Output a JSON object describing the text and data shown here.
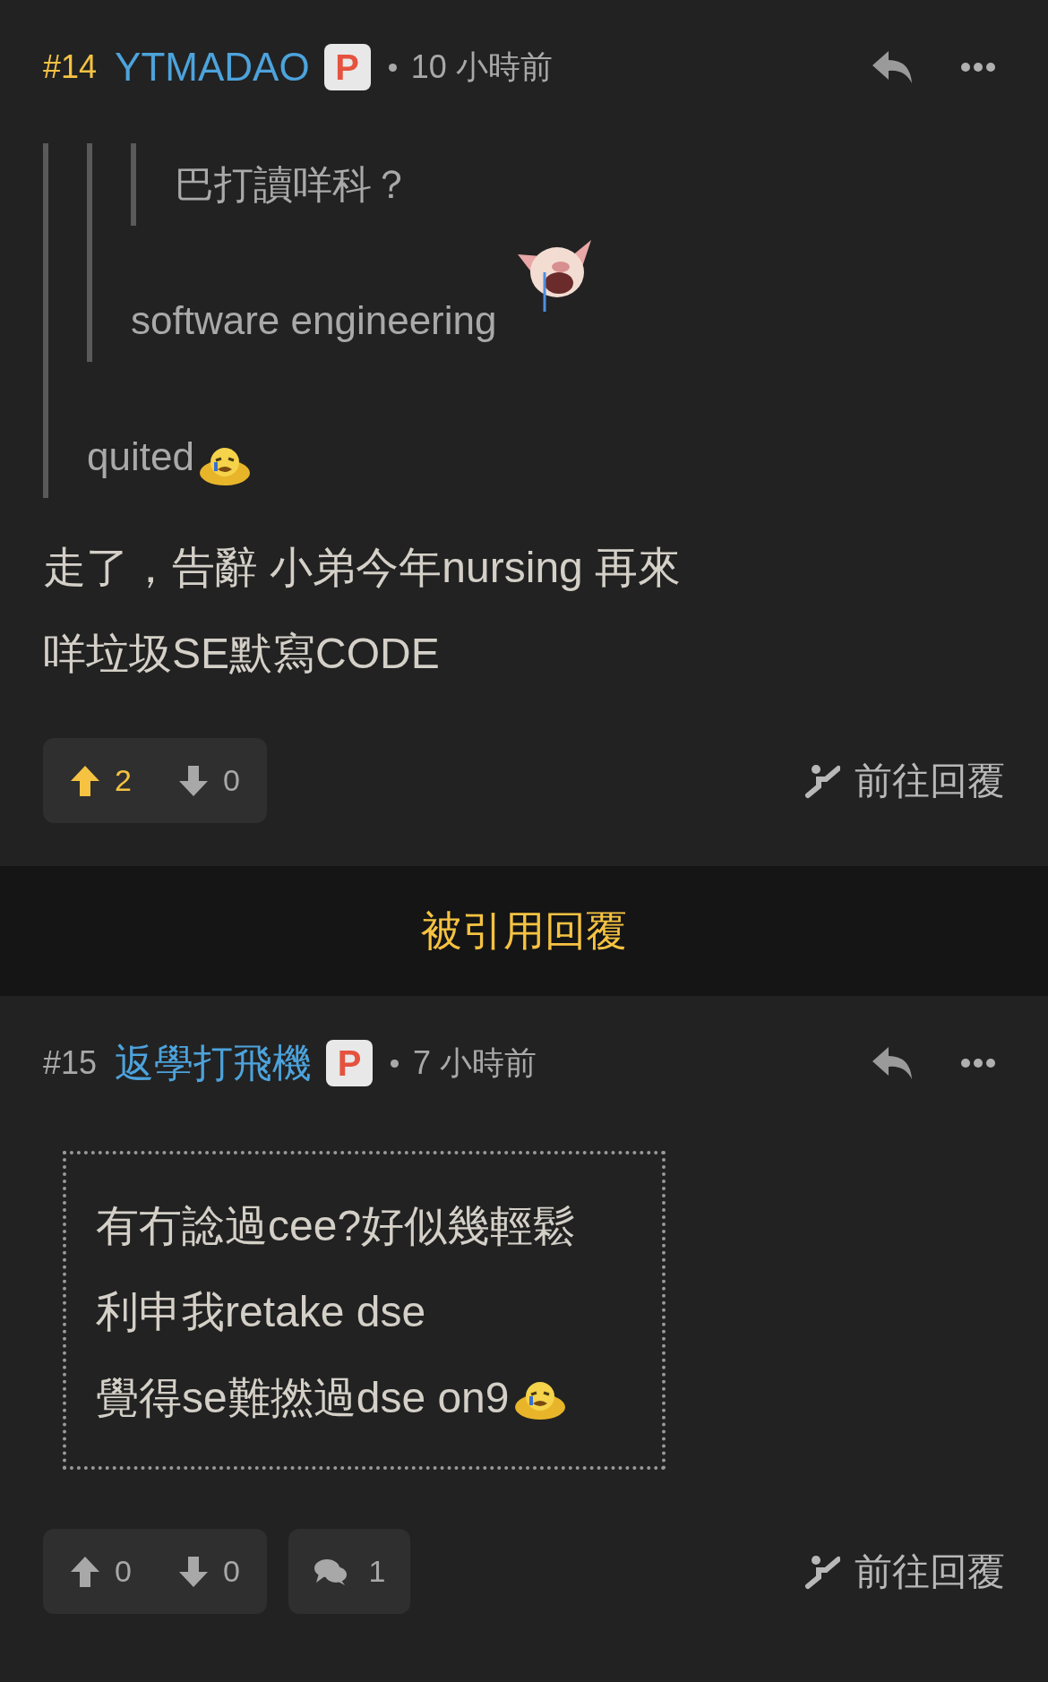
{
  "posts": [
    {
      "number": "#14",
      "highlighted": true,
      "username": "YTMADAO",
      "badge": "P",
      "time": "10 小時前",
      "quote": {
        "text": "quited",
        "emoji": {
          "kind": "crying"
        },
        "quote": {
          "text": "software engineering",
          "emoji": {
            "kind": "pig"
          },
          "quote": {
            "text": "巴打讀咩科？"
          }
        }
      },
      "boxed": false,
      "body": [
        "走了，告辭 小弟今年nursing 再來",
        "咩垃圾SE默寫CODE"
      ],
      "upvotes": "2",
      "downvotes": "0",
      "upvoted": true,
      "goto_reply": "前往回覆"
    },
    {
      "number": "#15",
      "highlighted": false,
      "username": "返學打飛機",
      "badge": "P",
      "time": "7 小時前",
      "boxed": true,
      "body": [
        "有冇諗過cee?好似幾輕鬆",
        "利申我retake dse",
        "覺得se難撚過dse on9"
      ],
      "body_emoji": {
        "kind": "crying"
      },
      "upvotes": "0",
      "downvotes": "0",
      "upvoted": false,
      "comments": "1",
      "goto_reply": "前往回覆"
    }
  ],
  "quoted_replies_bar": "被引用回覆"
}
